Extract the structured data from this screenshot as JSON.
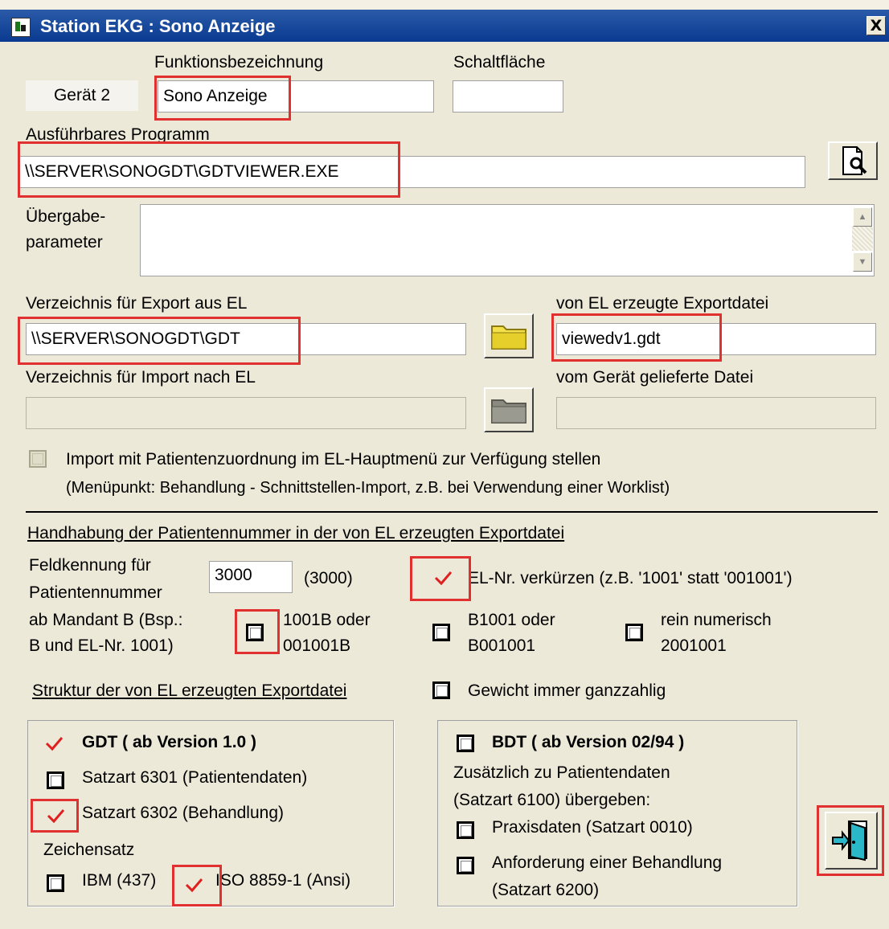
{
  "window": {
    "title": "Station EKG : Sono Anzeige",
    "close_label": "X"
  },
  "device": {
    "label": "Gerät 2",
    "function_label": "Funktionsbezeichnung",
    "function_value": "Sono Anzeige",
    "button_label": "Schaltfläche",
    "button_value": ""
  },
  "program": {
    "label": "Ausführbares Programm",
    "value": "\\\\SERVER\\SONOGDT\\GDTVIEWER.EXE",
    "params_label_1": "Übergabe-",
    "params_label_2": "parameter",
    "params_value": ""
  },
  "export": {
    "dir_label": "Verzeichnis für Export aus EL",
    "dir_value": "\\\\SERVER\\SONOGDT\\GDT",
    "file_label": "von EL erzeugte Exportdatei",
    "file_value": "viewedv1.gdt"
  },
  "import": {
    "dir_label": "Verzeichnis für Import nach EL",
    "dir_value": "",
    "file_label": "vom Gerät gelieferte Datei",
    "file_value": "",
    "menu_option": "Import mit Patientenzuordnung im EL-Hauptmenü zur Verfügung stellen",
    "menu_hint": "(Menüpunkt: Behandlung - Schnittstellen-Import, z.B. bei Verwendung einer Worklist)"
  },
  "patient": {
    "heading": "Handhabung der Patientennummer in der von EL erzeugten Exportdatei",
    "field_id_label_1": "Feldkennung für",
    "field_id_label_2": "Patientennummer",
    "field_id_value": "3000",
    "field_id_default": "(3000)",
    "shorten_label": "EL-Nr. verkürzen (z.B. '1001' statt '001001')",
    "mandant_label_1": "ab Mandant B (Bsp.:",
    "mandant_label_2": "B und EL-Nr. 1001)",
    "opt1_line1": "1001B oder",
    "opt1_line2": "001001B",
    "opt2_line1": "B1001 oder",
    "opt2_line2": "B001001",
    "opt3_line1": "rein numerisch",
    "opt3_line2": "2001001"
  },
  "structure": {
    "heading": "Struktur der von EL erzeugten Exportdatei",
    "weight_label": "Gewicht immer ganzzahlig"
  },
  "gdt": {
    "title": "GDT ( ab Version 1.0 )",
    "satz_6301": "Satzart 6301 (Patientendaten)",
    "satz_6302": "Satzart 6302 (Behandlung)",
    "charset_label": "Zeichensatz",
    "ibm": "IBM (437)",
    "iso": "ISO 8859-1 (Ansi)"
  },
  "bdt": {
    "title": "BDT ( ab Version 02/94 )",
    "line1": "Zusätzlich zu Patientendaten",
    "line2": "(Satzart 6100) übergeben:",
    "praxis": "Praxisdaten (Satzart 0010)",
    "anforderung_1": "Anforderung einer Behandlung",
    "anforderung_2": "(Satzart 6200)"
  },
  "colors": {
    "highlight": "#e03030",
    "check": "#e02020",
    "title_bar": "#0a3a90"
  }
}
